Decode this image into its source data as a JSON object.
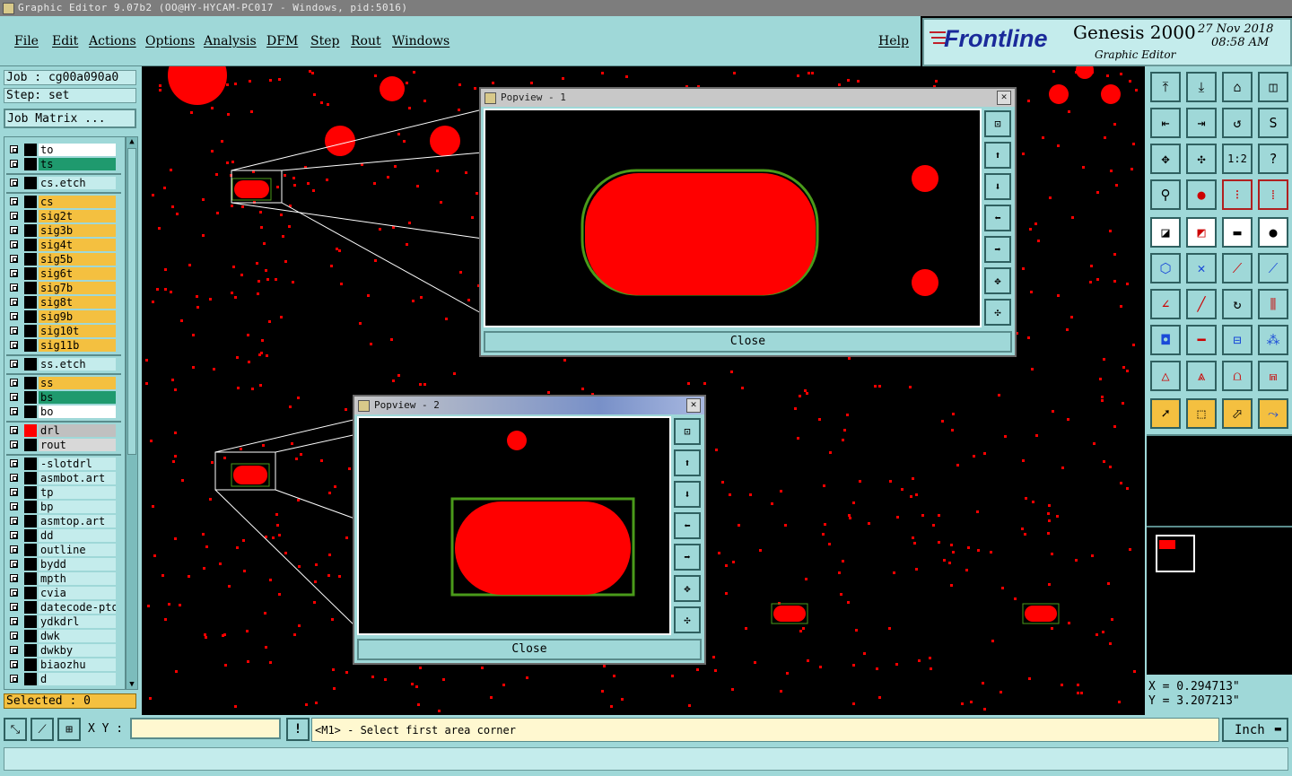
{
  "window": {
    "title": "Graphic Editor 9.07b2 (OO@HY-HYCAM-PC017 - Windows, pid:5016)"
  },
  "menu": {
    "items": [
      "File",
      "Edit",
      "Actions",
      "Options",
      "Analysis",
      "DFM",
      "Step",
      "Rout",
      "Windows"
    ],
    "help": "Help"
  },
  "brand": {
    "logo": "Frontline",
    "product": "Genesis 2000",
    "subtitle": "Graphic Editor",
    "date": "27 Nov 2018",
    "time": "08:58 AM"
  },
  "left": {
    "job": "Job : cg00a090a0",
    "step": "Step: set",
    "job_matrix": "Job Matrix ...",
    "selected": "Selected : 0",
    "layers": [
      {
        "name": "to",
        "color": "#ffffff",
        "swatch": "#000000"
      },
      {
        "name": "ts",
        "color": "#1f9a6e",
        "swatch": "#000000"
      },
      {
        "name": "cs.etch",
        "color": "#c4ecec",
        "swatch": "#000000"
      },
      {
        "name": "cs",
        "color": "#f4c040",
        "swatch": "#000000"
      },
      {
        "name": "sig2t",
        "color": "#f4c040",
        "swatch": "#000000"
      },
      {
        "name": "sig3b",
        "color": "#f4c040",
        "swatch": "#000000"
      },
      {
        "name": "sig4t",
        "color": "#f4c040",
        "swatch": "#000000"
      },
      {
        "name": "sig5b",
        "color": "#f4c040",
        "swatch": "#000000"
      },
      {
        "name": "sig6t",
        "color": "#f4c040",
        "swatch": "#000000"
      },
      {
        "name": "sig7b",
        "color": "#f4c040",
        "swatch": "#000000"
      },
      {
        "name": "sig8t",
        "color": "#f4c040",
        "swatch": "#000000"
      },
      {
        "name": "sig9b",
        "color": "#f4c040",
        "swatch": "#000000"
      },
      {
        "name": "sig10t",
        "color": "#f4c040",
        "swatch": "#000000"
      },
      {
        "name": "sig11b",
        "color": "#f4c040",
        "swatch": "#000000"
      },
      {
        "name": "ss.etch",
        "color": "#c4ecec",
        "swatch": "#000000"
      },
      {
        "name": "ss",
        "color": "#f4c040",
        "swatch": "#000000"
      },
      {
        "name": "bs",
        "color": "#1f9a6e",
        "swatch": "#000000"
      },
      {
        "name": "bo",
        "color": "#ffffff",
        "swatch": "#000000"
      },
      {
        "name": "drl",
        "color": "#c0c0c0",
        "swatch": "#ff0000"
      },
      {
        "name": "rout",
        "color": "#d8d8d8",
        "swatch": "#000000"
      },
      {
        "name": "-slotdrl",
        "color": "#c4ecec",
        "swatch": "#000000"
      },
      {
        "name": "asmbot.art",
        "color": "#c4ecec",
        "swatch": "#000000"
      },
      {
        "name": "tp",
        "color": "#c4ecec",
        "swatch": "#000000"
      },
      {
        "name": "bp",
        "color": "#c4ecec",
        "swatch": "#000000"
      },
      {
        "name": "asmtop.art",
        "color": "#c4ecec",
        "swatch": "#000000"
      },
      {
        "name": "dd",
        "color": "#c4ecec",
        "swatch": "#000000"
      },
      {
        "name": "outline",
        "color": "#c4ecec",
        "swatch": "#000000"
      },
      {
        "name": "bydd",
        "color": "#c4ecec",
        "swatch": "#000000"
      },
      {
        "name": "mpth",
        "color": "#c4ecec",
        "swatch": "#000000"
      },
      {
        "name": "cvia",
        "color": "#c4ecec",
        "swatch": "#000000"
      },
      {
        "name": "datecode-pto",
        "color": "#c4ecec",
        "swatch": "#000000"
      },
      {
        "name": "ydkdrl",
        "color": "#c4ecec",
        "swatch": "#000000"
      },
      {
        "name": "dwk",
        "color": "#c4ecec",
        "swatch": "#000000"
      },
      {
        "name": "dwkby",
        "color": "#c4ecec",
        "swatch": "#000000"
      },
      {
        "name": "biaozhu",
        "color": "#c4ecec",
        "swatch": "#000000"
      },
      {
        "name": "d",
        "color": "#c4ecec",
        "swatch": "#000000"
      }
    ]
  },
  "popview1": {
    "title": "Popview - 1",
    "close": "Close"
  },
  "popview2": {
    "title": "Popview - 2",
    "close": "Close"
  },
  "coords": {
    "x": "X  = 0.294713\"",
    "y": "Y  = 3.207213\""
  },
  "bottom": {
    "xy_label": "X Y :",
    "xy_value": "",
    "alert_icon": "!",
    "prompt": "<M1> - Select first area corner",
    "unit": "Inch"
  },
  "colors": {
    "pad": "#ff0000",
    "panel": "#9fd8d8",
    "outline": "#4a9a1a"
  }
}
